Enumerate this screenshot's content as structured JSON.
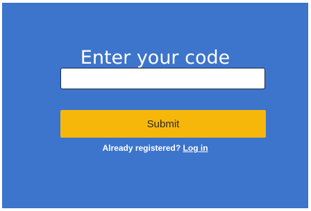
{
  "form": {
    "title": "Enter your code",
    "code_value": "",
    "code_placeholder": "",
    "submit_label": "Submit",
    "already_registered_text": "Already registered?",
    "login_link_label": "Log in"
  },
  "colors": {
    "panel_background": "#3d74cc",
    "submit_background": "#f6b70a",
    "text": "#ffffff"
  }
}
